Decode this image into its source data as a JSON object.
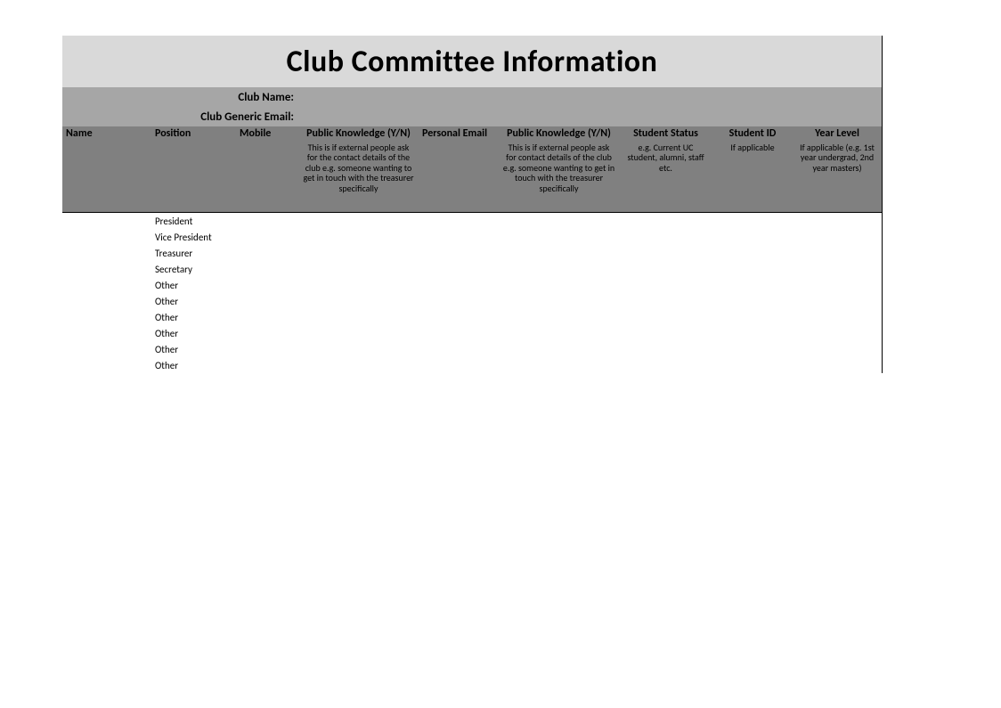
{
  "title": "Club Committee Information",
  "info": {
    "club_name_label": "Club Name:",
    "club_name_value": "",
    "club_email_label": "Club Generic Email:",
    "club_email_value": ""
  },
  "headers": {
    "name": "Name",
    "position": "Position",
    "mobile": "Mobile",
    "pk1": "Public Knowledge (Y/N)",
    "pk1_sub": "This is if external people ask for the contact details of the club e.g. someone wanting to get in touch with the treasurer specifically",
    "email": "Personal Email",
    "pk2": "Public Knowledge (Y/N)",
    "pk2_sub": "This is if external people ask for contact details of the club e.g. someone wanting to get in touch with the treasurer specifically",
    "status": "Student Status",
    "status_sub": "e.g. Current UC student, alumni, staff etc.",
    "sid": "Student ID",
    "sid_sub": "If applicable",
    "year": "Year Level",
    "year_sub": "If applicable (e.g. 1st year undergrad, 2nd year masters)"
  },
  "rows": [
    {
      "name": "",
      "position": "President",
      "mobile": "",
      "pk1": "",
      "email": "",
      "pk2": "",
      "status": "",
      "sid": "",
      "year": ""
    },
    {
      "name": "",
      "position": "Vice President",
      "mobile": "",
      "pk1": "",
      "email": "",
      "pk2": "",
      "status": "",
      "sid": "",
      "year": ""
    },
    {
      "name": "",
      "position": "Treasurer",
      "mobile": "",
      "pk1": "",
      "email": "",
      "pk2": "",
      "status": "",
      "sid": "",
      "year": ""
    },
    {
      "name": "",
      "position": "Secretary",
      "mobile": "",
      "pk1": "",
      "email": "",
      "pk2": "",
      "status": "",
      "sid": "",
      "year": ""
    },
    {
      "name": "",
      "position": "Other",
      "mobile": "",
      "pk1": "",
      "email": "",
      "pk2": "",
      "status": "",
      "sid": "",
      "year": ""
    },
    {
      "name": "",
      "position": "Other",
      "mobile": "",
      "pk1": "",
      "email": "",
      "pk2": "",
      "status": "",
      "sid": "",
      "year": ""
    },
    {
      "name": "",
      "position": "Other",
      "mobile": "",
      "pk1": "",
      "email": "",
      "pk2": "",
      "status": "",
      "sid": "",
      "year": ""
    },
    {
      "name": "",
      "position": "Other",
      "mobile": "",
      "pk1": "",
      "email": "",
      "pk2": "",
      "status": "",
      "sid": "",
      "year": ""
    },
    {
      "name": "",
      "position": "Other",
      "mobile": "",
      "pk1": "",
      "email": "",
      "pk2": "",
      "status": "",
      "sid": "",
      "year": ""
    },
    {
      "name": "",
      "position": "Other",
      "mobile": "",
      "pk1": "",
      "email": "",
      "pk2": "",
      "status": "",
      "sid": "",
      "year": ""
    }
  ]
}
